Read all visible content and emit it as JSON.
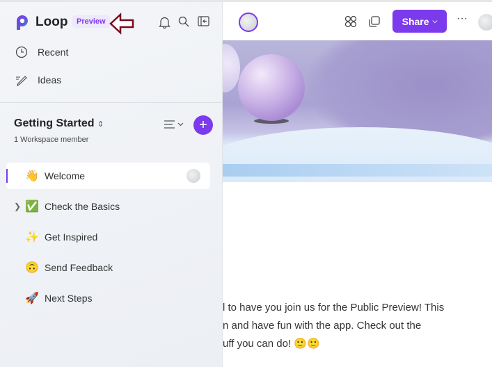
{
  "app": {
    "name": "Loop",
    "badge": "Preview"
  },
  "sidebar": {
    "nav": [
      {
        "label": "Recent",
        "icon": "clock-icon"
      },
      {
        "label": "Ideas",
        "icon": "pen-icon"
      }
    ],
    "workspace": {
      "title": "Getting Started",
      "subtitle": "1 Workspace member"
    },
    "pages": [
      {
        "label": "Welcome",
        "emoji": "👋",
        "selected": true
      },
      {
        "label": "Check the Basics",
        "emoji": "✅",
        "expandable": true
      },
      {
        "label": "Get Inspired",
        "emoji": "✨"
      },
      {
        "label": "Send Feedback",
        "emoji": "🙃"
      },
      {
        "label": "Next Steps",
        "emoji": "🚀"
      }
    ]
  },
  "toolbar": {
    "share_label": "Share",
    "more_label": "···"
  },
  "content": {
    "lines": [
      "l to have you join us for the Public Preview! This",
      "n and have fun with the app. Check out the",
      "uff you can do! 🙂🙂"
    ]
  },
  "colors": {
    "accent": "#7c3aed",
    "annotation_arrow": "#7a0a1e"
  }
}
